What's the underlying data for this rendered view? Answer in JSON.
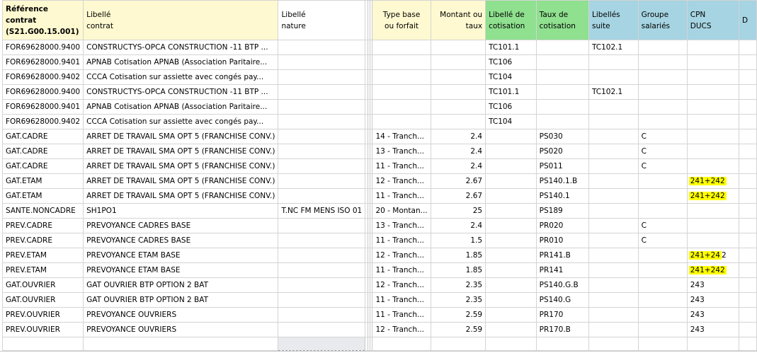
{
  "headers": [
    {
      "l1": "Référence",
      "l2": "contrat",
      "l3": "(S21.G00.15.001)"
    },
    {
      "l1": "Libellé",
      "l2": "contrat"
    },
    {
      "l1": "Libellé",
      "l2": "nature"
    },
    {
      "l1": "Type base",
      "l2": "ou forfait"
    },
    {
      "l1": "Montant ou",
      "l2": "taux"
    },
    {
      "l1": "Libellé de",
      "l2": "cotisation"
    },
    {
      "l1": "Taux de",
      "l2": "cotisation"
    },
    {
      "l1": "Libellés",
      "l2": "suite"
    },
    {
      "l1": "Groupe",
      "l2": "salariés"
    },
    {
      "l1": "CPN",
      "l2": "DUCS"
    },
    {
      "l1": "D"
    }
  ],
  "rows": [
    {
      "ref": "FOR69628000.9400",
      "lib": "CONSTRUCTYS-OPCA CONSTRUCTION -11 BTP ...",
      "nature": "",
      "type": "",
      "montant": "",
      "libcot": "TC101.1",
      "taux": "",
      "suite": "TC102.1",
      "groupe": "",
      "cpn": ""
    },
    {
      "ref": "FOR69628000.9401",
      "lib": "APNAB Cotisation APNAB (Association Paritaire...",
      "nature": "",
      "type": "",
      "montant": "",
      "libcot": "TC106",
      "taux": "",
      "suite": "",
      "groupe": "",
      "cpn": ""
    },
    {
      "ref": "FOR69628000.9402",
      "lib": "CCCA Cotisation sur assiette avec congés pay...",
      "nature": "",
      "type": "",
      "montant": "",
      "libcot": "TC104",
      "taux": "",
      "suite": "",
      "groupe": "",
      "cpn": ""
    },
    {
      "ref": "FOR69628000.9400",
      "lib": "CONSTRUCTYS-OPCA CONSTRUCTION -11 BTP ...",
      "nature": "",
      "type": "",
      "montant": "",
      "libcot": "TC101.1",
      "taux": "",
      "suite": "TC102.1",
      "groupe": "",
      "cpn": ""
    },
    {
      "ref": "FOR69628000.9401",
      "lib": "APNAB Cotisation APNAB (Association Paritaire...",
      "nature": "",
      "type": "",
      "montant": "",
      "libcot": "TC106",
      "taux": "",
      "suite": "",
      "groupe": "",
      "cpn": ""
    },
    {
      "ref": "FOR69628000.9402",
      "lib": "CCCA Cotisation sur assiette avec congés pay...",
      "nature": "",
      "type": "",
      "montant": "",
      "libcot": "TC104",
      "taux": "",
      "suite": "",
      "groupe": "",
      "cpn": ""
    },
    {
      "ref": "GAT.CADRE",
      "lib": "ARRET DE TRAVAIL SMA OPT 5 (FRANCHISE CONV.)",
      "nature": "",
      "type": "14 - Tranch...",
      "montant": "2.4",
      "libcot": "",
      "taux": "PS030",
      "suite": "",
      "groupe": "C",
      "cpn": ""
    },
    {
      "ref": "GAT.CADRE",
      "lib": "ARRET DE TRAVAIL SMA OPT 5 (FRANCHISE CONV.)",
      "nature": "",
      "type": "13 - Tranch...",
      "montant": "2.4",
      "libcot": "",
      "taux": "PS020",
      "suite": "",
      "groupe": "C",
      "cpn": ""
    },
    {
      "ref": "GAT.CADRE",
      "lib": "ARRET DE TRAVAIL SMA OPT 5 (FRANCHISE CONV.)",
      "nature": "",
      "type": "11 - Tranch...",
      "montant": "2.4",
      "libcot": "",
      "taux": "PS011",
      "suite": "",
      "groupe": "C",
      "cpn": ""
    },
    {
      "ref": "GAT.ETAM",
      "lib": "ARRET DE TRAVAIL SMA OPT 5 (FRANCHISE CONV.)",
      "nature": "",
      "type": "12 - Tranch...",
      "montant": "2.67",
      "libcot": "",
      "taux": "PS140.1.B",
      "suite": "",
      "groupe": "",
      "cpn": "241+242",
      "cpn_hl": "241+242"
    },
    {
      "ref": "GAT.ETAM",
      "lib": "ARRET DE TRAVAIL SMA OPT 5 (FRANCHISE CONV.)",
      "nature": "",
      "type": "11 - Tranch...",
      "montant": "2.67",
      "libcot": "",
      "taux": "PS140.1",
      "suite": "",
      "groupe": "",
      "cpn": "241+242",
      "cpn_hl": "241+242"
    },
    {
      "ref": "SANTE.NONCADRE",
      "lib": "SH1PO1",
      "nature": "T.NC FM MENS ISO  01",
      "type": "20 - Montan...",
      "montant": "25",
      "libcot": "",
      "taux": "PS189",
      "suite": "",
      "groupe": "",
      "cpn": ""
    },
    {
      "ref": "PREV.CADRE",
      "lib": "PREVOYANCE CADRES BASE",
      "nature": "",
      "type": "13 - Tranch...",
      "montant": "2.4",
      "libcot": "",
      "taux": "PR020",
      "suite": "",
      "groupe": "C",
      "cpn": ""
    },
    {
      "ref": "PREV.CADRE",
      "lib": "PREVOYANCE CADRES BASE",
      "nature": "",
      "type": "11 - Tranch...",
      "montant": "1.5",
      "libcot": "",
      "taux": "PR010",
      "suite": "",
      "groupe": "C",
      "cpn": ""
    },
    {
      "ref": "PREV.ETAM",
      "lib": "PREVOYANCE ETAM BASE",
      "nature": "",
      "type": "12 - Tranch...",
      "montant": "1.85",
      "libcot": "",
      "taux": "PR141.B",
      "suite": "",
      "groupe": "",
      "cpn": "241+242",
      "cpn_hl": "241+24",
      "cpn_rest": "2"
    },
    {
      "ref": "PREV.ETAM",
      "lib": "PREVOYANCE ETAM BASE",
      "nature": "",
      "type": "11 - Tranch...",
      "montant": "1.85",
      "libcot": "",
      "taux": "PR141",
      "suite": "",
      "groupe": "",
      "cpn": "241+242",
      "cpn_hl": "241+242"
    },
    {
      "ref": "GAT.OUVRIER",
      "lib": "GAT OUVRIER BTP OPTION 2 BAT",
      "nature": "",
      "type": "12 - Tranch...",
      "montant": "2.35",
      "libcot": "",
      "taux": "PS140.G.B",
      "suite": "",
      "groupe": "",
      "cpn": "243"
    },
    {
      "ref": "GAT.OUVRIER",
      "lib": "GAT OUVRIER BTP OPTION 2 BAT",
      "nature": "",
      "type": "11 - Tranch...",
      "montant": "2.35",
      "libcot": "",
      "taux": "PS140.G",
      "suite": "",
      "groupe": "",
      "cpn": "243"
    },
    {
      "ref": "PREV.OUVRIER",
      "lib": "PREVOYANCE OUVRIERS",
      "nature": "",
      "type": "11 - Tranch...",
      "montant": "2.59",
      "libcot": "",
      "taux": "PR170",
      "suite": "",
      "groupe": "",
      "cpn": "243"
    },
    {
      "ref": "PREV.OUVRIER",
      "lib": "PREVOYANCE OUVRIERS",
      "nature": "",
      "type": "12 - Tranch...",
      "montant": "2.59",
      "libcot": "",
      "taux": "PR170.B",
      "suite": "",
      "groupe": "",
      "cpn": "243"
    }
  ]
}
